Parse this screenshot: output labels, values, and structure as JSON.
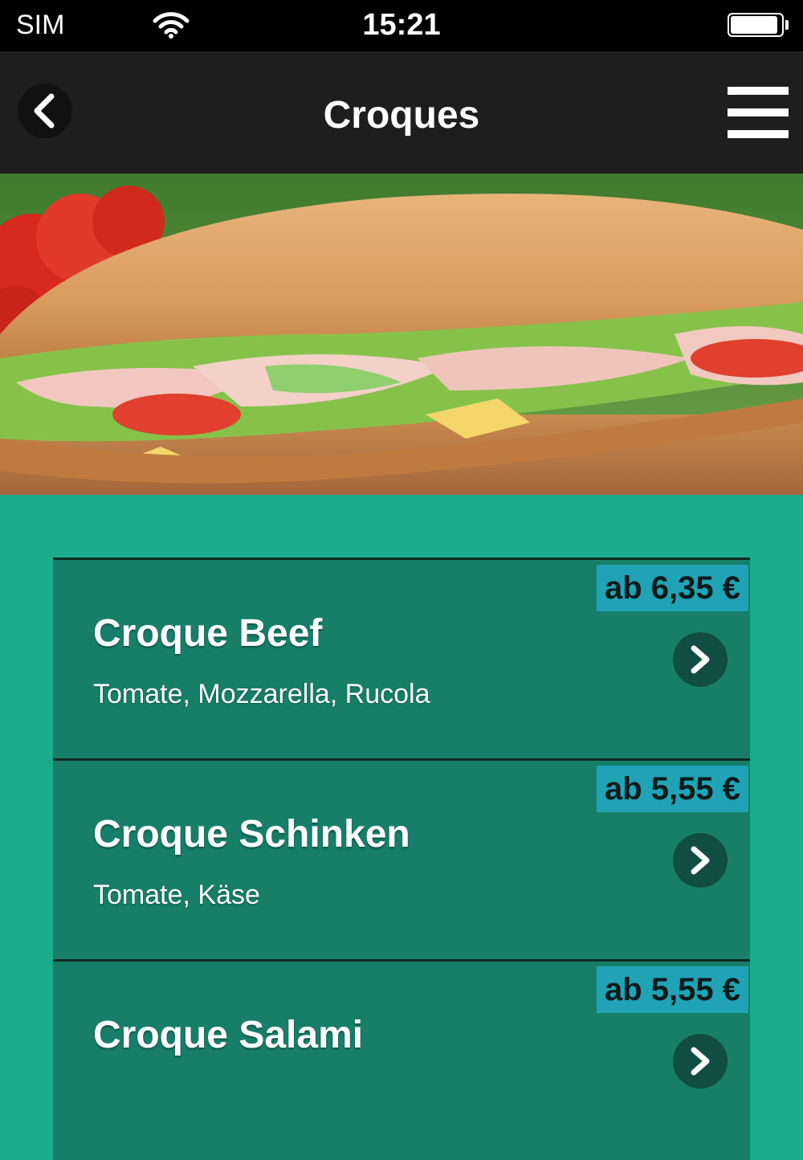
{
  "status_bar": {
    "carrier": "SIM",
    "time": "15:21",
    "wifi_icon": "wifi-icon",
    "battery_icon": "battery-icon"
  },
  "nav": {
    "title": "Croques",
    "back_icon": "chevron-left-icon",
    "menu_icon": "hamburger-menu-icon"
  },
  "hero": {
    "image": "baguette-sandwich-photo"
  },
  "items": [
    {
      "name": "Croque Beef",
      "description": "Tomate, Mozzarella, Rucola",
      "price": "ab 6,35 €"
    },
    {
      "name": "Croque Schinken",
      "description": "Tomate, Käse",
      "price": "ab 5,55 €"
    },
    {
      "name": "Croque Salami",
      "description": "",
      "price": "ab 5,55 €"
    }
  ],
  "colors": {
    "background": "#1aac8c",
    "item_background": "#177f69",
    "price_badge": "#1fa3b5",
    "nav_background": "#1e1e1e"
  }
}
